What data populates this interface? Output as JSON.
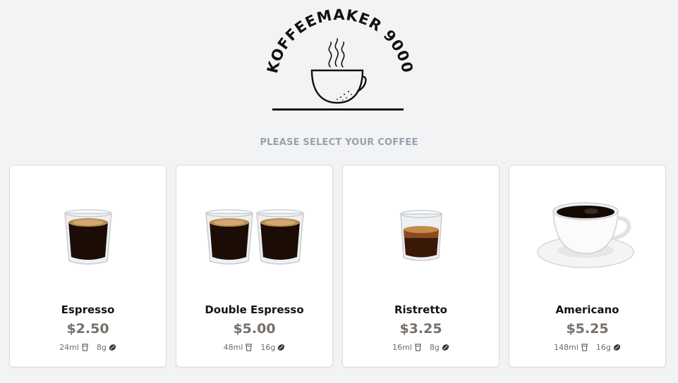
{
  "brand": {
    "name": "KOFFEEMAKER 9000"
  },
  "prompt": "PLEASE SELECT YOUR COFFEE",
  "colors": {
    "background": "#f2f3f5",
    "card": "#ffffff",
    "price": "#77706a",
    "prompt": "#9aa1ab"
  },
  "coffees": [
    {
      "name": "Espresso",
      "price": "$2.50",
      "volume": "24ml",
      "beans": "8g",
      "image": "espresso-glass"
    },
    {
      "name": "Double Espresso",
      "price": "$5.00",
      "volume": "48ml",
      "beans": "16g",
      "image": "double-espresso-glasses"
    },
    {
      "name": "Ristretto",
      "price": "$3.25",
      "volume": "16ml",
      "beans": "8g",
      "image": "ristretto-glass"
    },
    {
      "name": "Americano",
      "price": "$5.25",
      "volume": "148ml",
      "beans": "16g",
      "image": "americano-cup"
    }
  ],
  "icons": {
    "volume": "cup-icon",
    "beans": "coffee-bean-icon"
  }
}
